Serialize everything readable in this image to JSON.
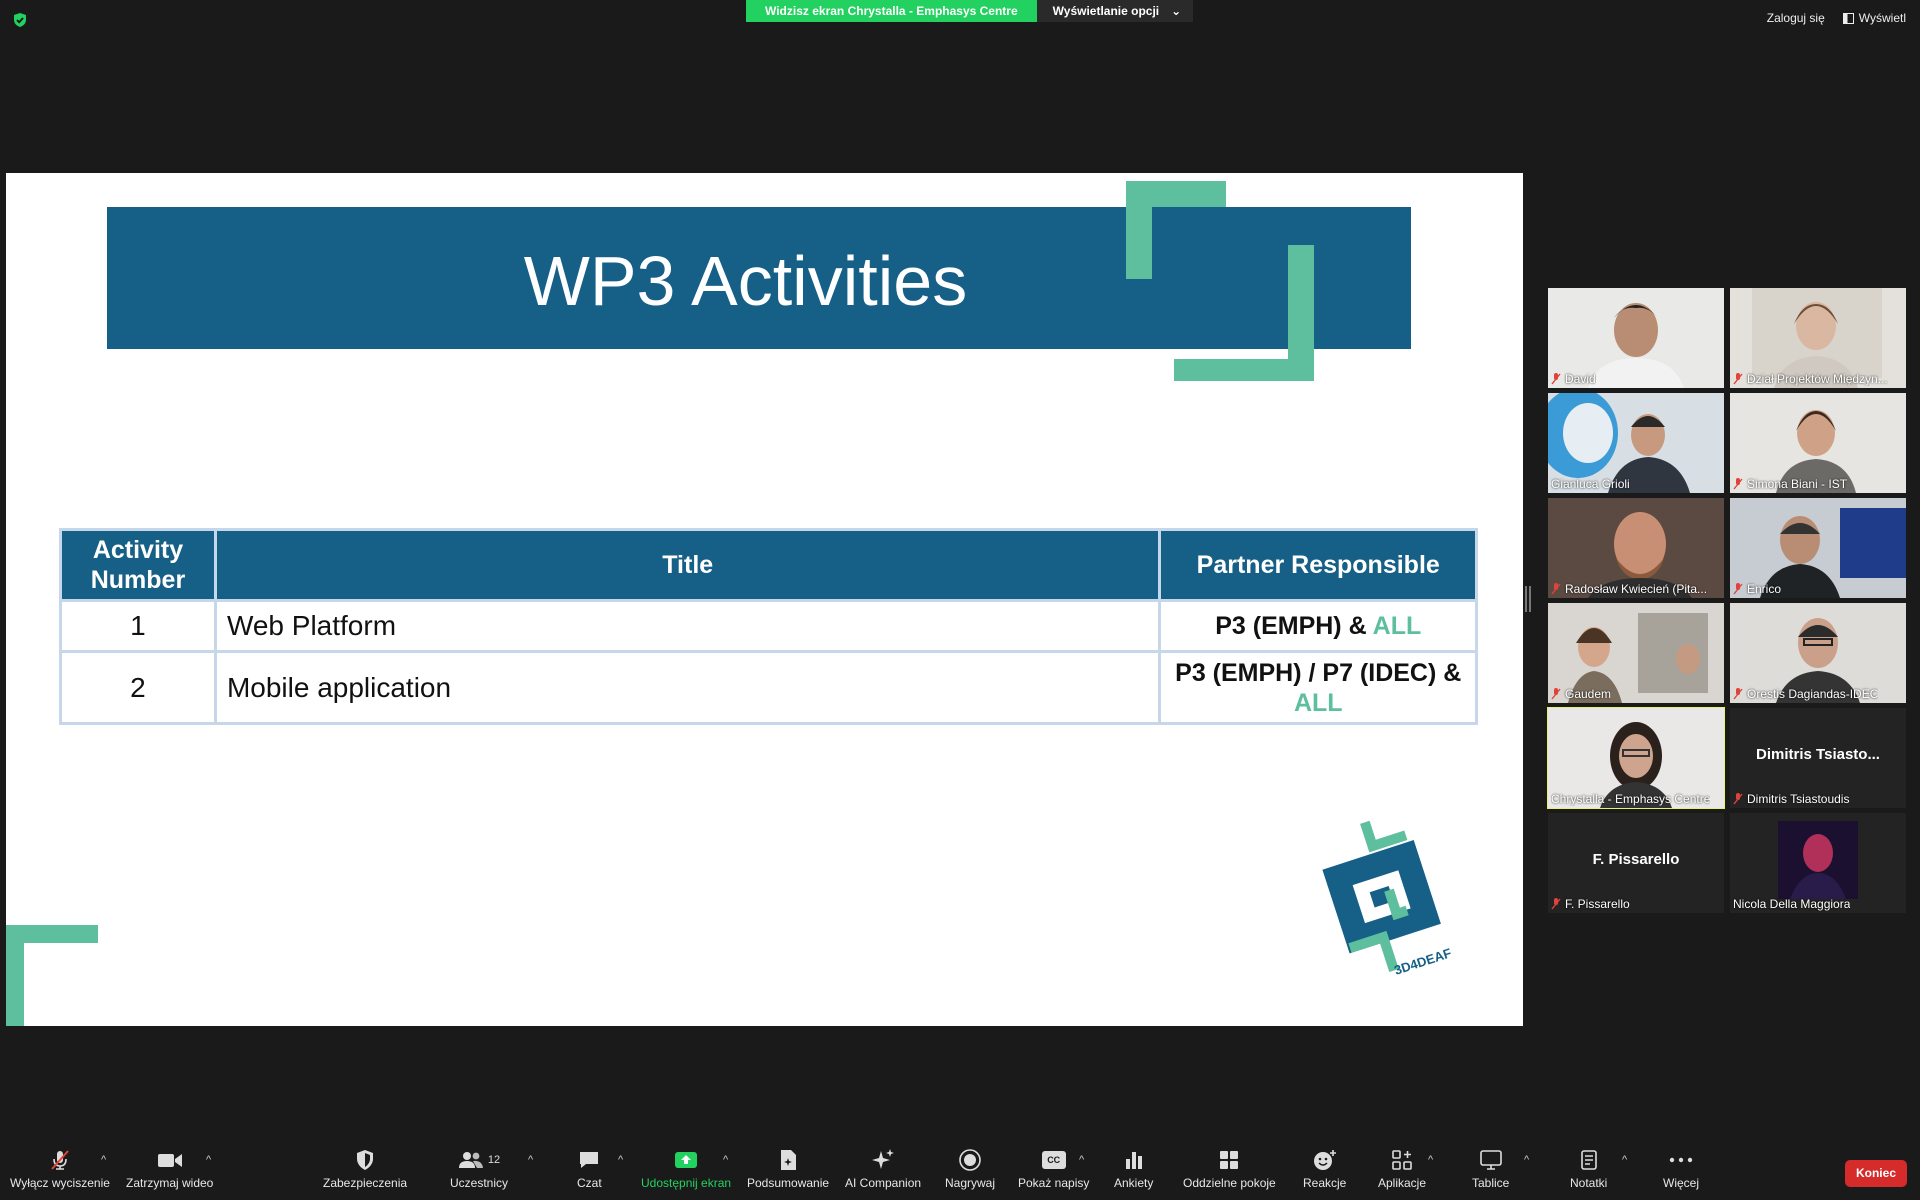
{
  "top_bar": {
    "share_banner": "Widzisz ekran Chrystalla - Emphasys Centre",
    "view_options": "Wyświetlanie opcji",
    "login": "Zaloguj się",
    "view": "Wyświetl"
  },
  "slide": {
    "title": "WP3 Activities",
    "logo_text": "3D4DEAF",
    "table": {
      "headers": [
        "Activity Number",
        "Title",
        "Partner Responsible"
      ],
      "rows": [
        {
          "number": "1",
          "title": "Web Platform",
          "partner_main": "P3 (EMPH) &",
          "partner_accent": "ALL"
        },
        {
          "number": "2",
          "title": "Mobile application",
          "partner_main": "P3 (EMPH) / P7 (IDEC) &",
          "partner_accent": "ALL"
        }
      ]
    },
    "colors": {
      "band": "#165f86",
      "accent": "#5ebf9e"
    }
  },
  "participants": [
    {
      "name": "David",
      "muted": true,
      "video": true
    },
    {
      "name": "Dział Projektów Międzyn...",
      "muted": true,
      "video": true
    },
    {
      "name": "Gianluca Grioli",
      "muted": false,
      "video": true
    },
    {
      "name": "Simona Biani - IST",
      "muted": true,
      "video": true
    },
    {
      "name": "Radosław Kwiecień (Pita...",
      "muted": true,
      "video": true
    },
    {
      "name": "Enrico",
      "muted": true,
      "video": true
    },
    {
      "name": "Gaudem",
      "muted": true,
      "video": true
    },
    {
      "name": "Orestis Dagiandas-IDEC",
      "muted": true,
      "video": true
    },
    {
      "name": "Chrystalla - Emphasys Centre",
      "muted": false,
      "video": true,
      "active": true
    },
    {
      "name": "Dimitris Tsiastoudis",
      "display": "Dimitris  Tsiasto...",
      "muted": true,
      "video": false
    },
    {
      "name": "F. Pissarello",
      "display": "F. Pissarello",
      "muted": true,
      "video": false
    },
    {
      "name": "Nicola Della Maggiora",
      "muted": false,
      "video": true
    }
  ],
  "toolbar": {
    "mute": "Wyłącz wyciszenie",
    "video": "Zatrzymaj wideo",
    "security": "Zabezpieczenia",
    "participants": "Uczestnicy",
    "participants_count": "12",
    "chat": "Czat",
    "share": "Udostępnij ekran",
    "summary": "Podsumowanie",
    "ai": "AI Companion",
    "record": "Nagrywaj",
    "captions": "Pokaż napisy",
    "captions_icon": "CC",
    "polls": "Ankiety",
    "breakout": "Oddzielne pokoje",
    "reactions": "Reakcje",
    "apps": "Aplikacje",
    "whiteboards": "Tablice",
    "notes": "Notatki",
    "more": "Więcej",
    "end": "Koniec"
  }
}
